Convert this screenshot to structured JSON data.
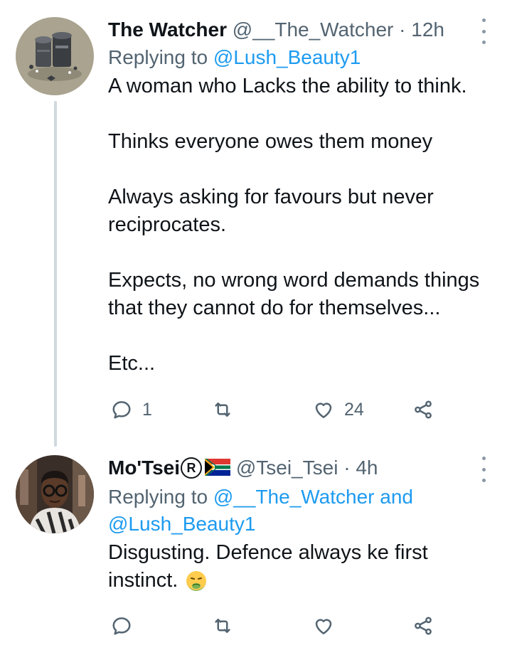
{
  "tweets": [
    {
      "display_name": "The Watcher",
      "handle": "@__The_Watcher",
      "separator": "·",
      "time": "12h",
      "reply_prefix": "Replying to",
      "reply_mentions": "@Lush_Beauty1",
      "body": "A woman who Lacks the ability to think.\n\nThinks everyone owes them money\n\nAlways asking for favours but never reciprocates.\n\nExpects, no wrong word demands things that they cannot do for themselves...\n\nEtc...",
      "reply_count": "1",
      "retweet_count": "",
      "like_count": "24",
      "avatar_icon": "trash-bins-illustration"
    },
    {
      "display_name": "Mo'Tsei",
      "name_badges": [
        "registered-icon",
        "south-africa-flag-icon"
      ],
      "badge_letter": "R",
      "handle": "@Tsei_Tsei",
      "separator": "·",
      "time": "4h",
      "reply_prefix": "Replying to",
      "reply_mentions_1": "@__The_Watcher and",
      "reply_mentions_2": "@Lush_Beauty1",
      "body": "Disgusting.  Defence always  ke first instinct.",
      "body_emoji": "nauseated-face-emoji",
      "reply_count": "",
      "retweet_count": "",
      "like_count": "",
      "avatar_icon": "profile-photo"
    }
  ],
  "colors": {
    "text": "#0f1419",
    "secondary": "#536471",
    "link": "#1d9bf0",
    "thread_line": "#cfd9de"
  }
}
